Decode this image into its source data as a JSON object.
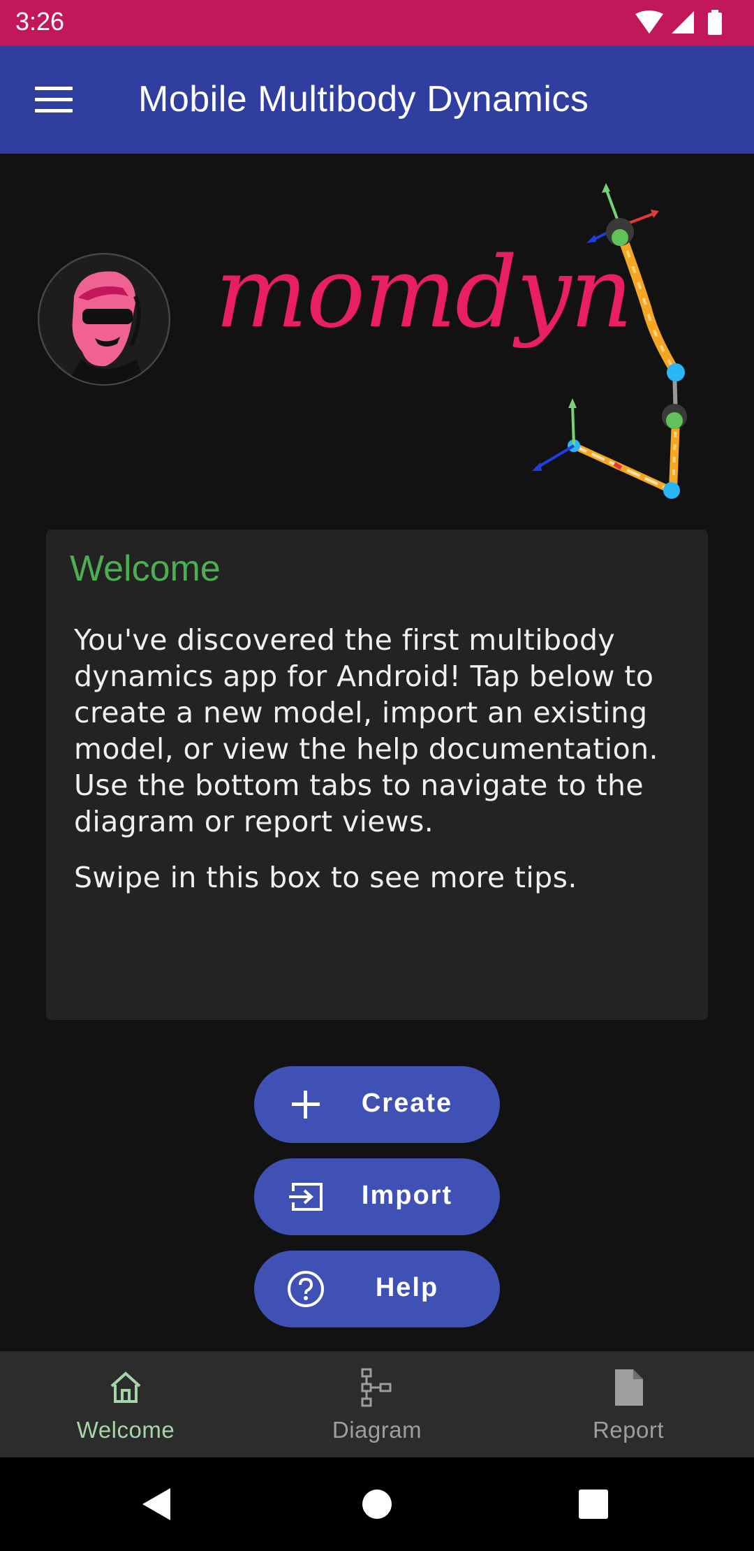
{
  "status_bar": {
    "time": "3:26"
  },
  "app_bar": {
    "title": "Mobile Multibody Dynamics"
  },
  "hero": {
    "logo_text": "momdyn"
  },
  "welcome_card": {
    "title": "Welcome",
    "paragraph1": "You've discovered the first multibody dynamics app for Android! Tap below to create a new model, import an existing model, or view the help documentation. Use the bottom tabs to navigate to the diagram or report views.",
    "paragraph2": "Swipe in this box to see more tips."
  },
  "actions": {
    "create_label": "Create",
    "import_label": "Import",
    "help_label": "Help"
  },
  "bottom_nav": {
    "items": [
      {
        "label": "Welcome",
        "icon": "home-icon",
        "active": true
      },
      {
        "label": "Diagram",
        "icon": "diagram-icon",
        "active": false
      },
      {
        "label": "Report",
        "icon": "document-icon",
        "active": false
      }
    ]
  },
  "colors": {
    "status_bar": "#c2185b",
    "app_bar": "#303f9f",
    "accent_pink": "#e91e63",
    "welcome_green": "#4caf50",
    "button": "#3f51b5",
    "nav_active": "#a5d6a7"
  }
}
